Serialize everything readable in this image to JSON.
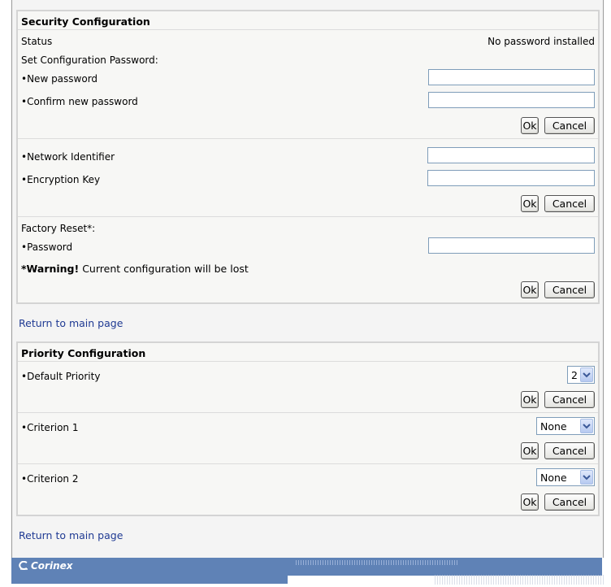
{
  "security": {
    "title": "Security Configuration",
    "status_label": "Status",
    "status_value": "No password installed",
    "set_password_label": "Set Configuration Password:",
    "new_password_label": "•New password",
    "confirm_password_label": "•Confirm new password",
    "new_password_value": "",
    "confirm_password_value": "",
    "network_identifier_label": "•Network Identifier",
    "encryption_key_label": "•Encryption Key",
    "network_identifier_value": "",
    "encryption_key_value": "",
    "factory_reset_label": "Factory Reset*:",
    "factory_password_label": "•Password",
    "factory_password_value": "",
    "warning_bold": "*Warning!",
    "warning_text": " Current configuration will be lost",
    "ok_label": "Ok",
    "cancel_label": "Cancel"
  },
  "return_link": "Return to main page",
  "priority": {
    "title": "Priority Configuration",
    "default_priority_label": "•Default Priority",
    "default_priority_value": "2",
    "criterion1_label": "•Criterion 1",
    "criterion1_value": "None",
    "criterion2_label": "•Criterion 2",
    "criterion2_value": "None",
    "ok_label": "Ok",
    "cancel_label": "Cancel"
  },
  "footer": {
    "brand": "Corinex"
  }
}
